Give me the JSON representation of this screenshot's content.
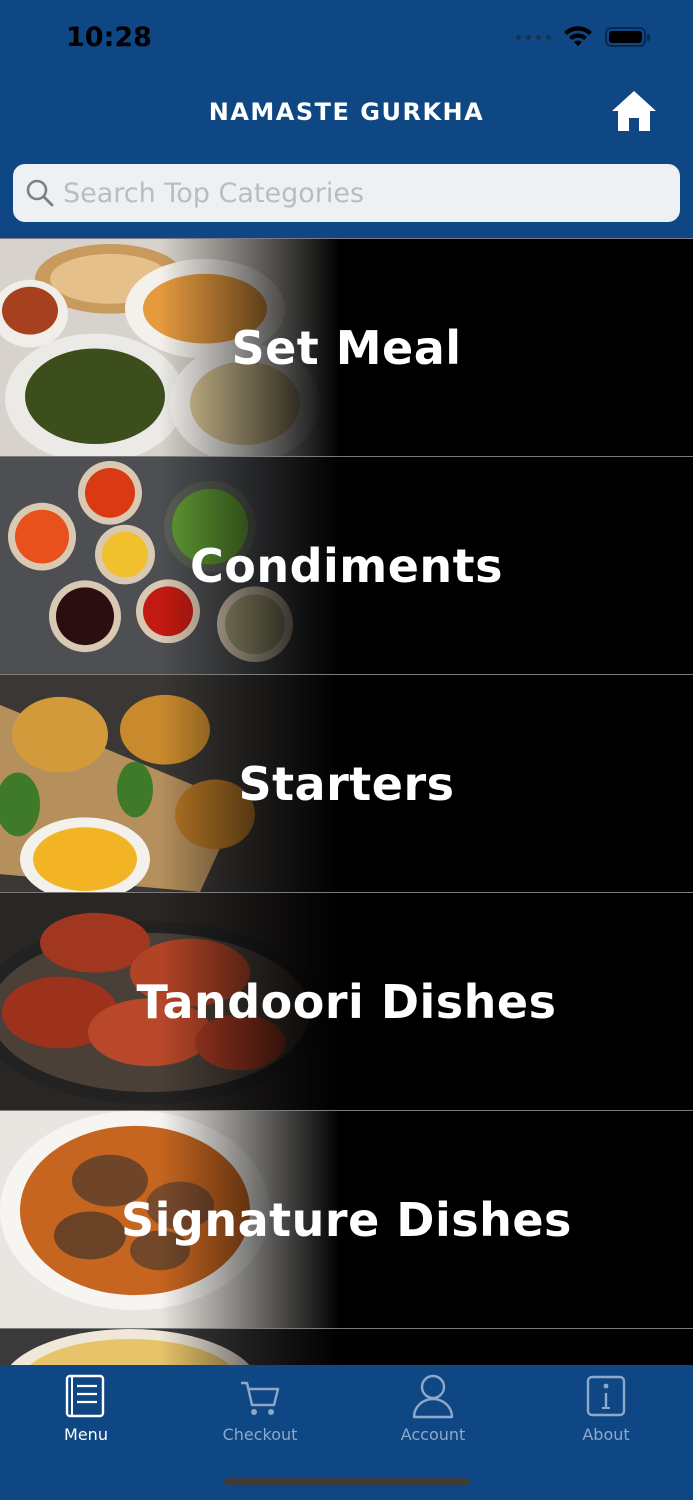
{
  "status": {
    "time": "10:28"
  },
  "header": {
    "title": "NAMASTE GURKHA",
    "home_icon": "home-icon"
  },
  "search": {
    "placeholder": "Search Top Categories",
    "icon": "search-icon"
  },
  "categories": [
    {
      "label": "Set Meal"
    },
    {
      "label": "Condiments"
    },
    {
      "label": "Starters"
    },
    {
      "label": "Tandoori Dishes"
    },
    {
      "label": "Signature Dishes"
    }
  ],
  "tabs": [
    {
      "label": "Menu",
      "icon": "menu-icon",
      "active": true
    },
    {
      "label": "Checkout",
      "icon": "cart-icon",
      "active": false
    },
    {
      "label": "Account",
      "icon": "account-icon",
      "active": false
    },
    {
      "label": "About",
      "icon": "info-icon",
      "active": false
    }
  ],
  "colors": {
    "brand": "#0f4784",
    "row_bg": "#000000",
    "text": "#ffffff",
    "tab_inactive": "#8ea8c9"
  }
}
